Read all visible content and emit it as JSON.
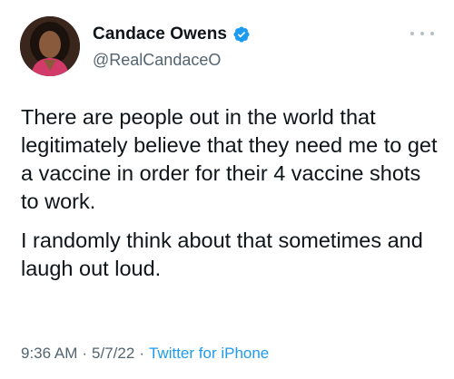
{
  "author": {
    "display_name": "Candace Owens",
    "handle": "@RealCandaceO",
    "verified": true,
    "avatar_icon": "profile-photo"
  },
  "more_icon": "more-horizontal-icon",
  "tweet": {
    "paragraphs": [
      "There are people out in the world that legitimately believe that they need me to get a vaccine in order for their 4 vaccine shots to work.",
      "I randomly think about that sometimes and laugh out loud."
    ]
  },
  "meta": {
    "time": "9:36 AM",
    "separator": "·",
    "date": "5/7/22",
    "source": "Twitter for iPhone"
  },
  "colors": {
    "text": "#0f1419",
    "secondary": "#536471",
    "accent": "#1d9bf0"
  }
}
